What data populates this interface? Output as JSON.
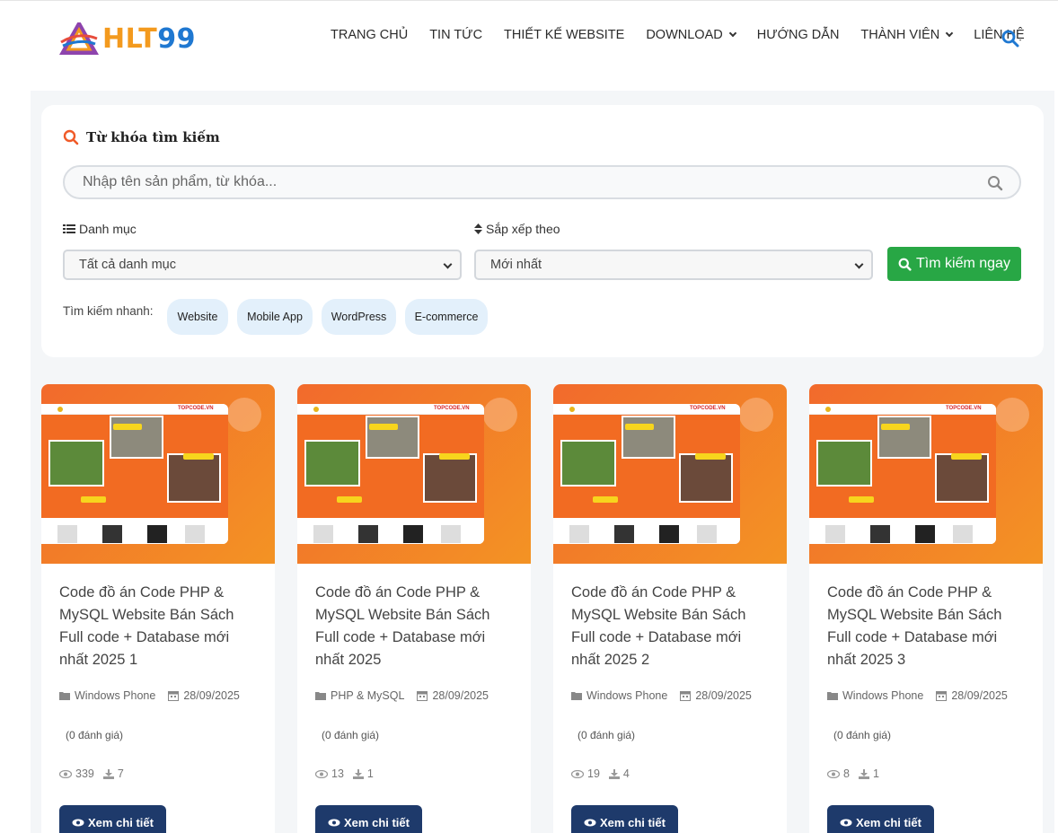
{
  "brand": {
    "logo_hlt": "HLT",
    "logo_num": "99"
  },
  "nav": {
    "items": [
      {
        "label": "TRANG CHỦ",
        "dropdown": false
      },
      {
        "label": "TIN TỨC",
        "dropdown": false
      },
      {
        "label": "THIẾT KẾ WEBSITE",
        "dropdown": false
      },
      {
        "label": "DOWNLOAD",
        "dropdown": true
      },
      {
        "label": "HƯỚNG DẪN",
        "dropdown": false
      },
      {
        "label": "THÀNH VIÊN",
        "dropdown": true
      },
      {
        "label": "LIÊN HỆ",
        "dropdown": false
      }
    ]
  },
  "search": {
    "title": "Từ khóa tìm kiếm",
    "placeholder": "Nhập tên sản phẩm, từ khóa...",
    "category_label": "Danh mục",
    "category_value": "Tất cả danh mục",
    "sort_label": "Sắp xếp theo",
    "sort_value": "Mới nhất",
    "button_label": "Tìm kiếm ngay",
    "quick_label": "Tìm kiếm nhanh:",
    "chips": [
      "Website",
      "Mobile App",
      "WordPress",
      "E-commerce"
    ]
  },
  "products": [
    {
      "title": "Code đồ án Code PHP & MySQL Website Bán Sách Full code + Database mới nhất 2025 1",
      "category": "Windows Phone",
      "date": "28/09/2025",
      "rating": "(0 đánh giá)",
      "views": "339",
      "downloads": "7",
      "button": "Xem chi tiết"
    },
    {
      "title": "Code đồ án Code PHP & MySQL Website Bán Sách Full code + Database mới nhất 2025",
      "category": "PHP & MySQL",
      "date": "28/09/2025",
      "rating": "(0 đánh giá)",
      "views": "13",
      "downloads": "1",
      "button": "Xem chi tiết"
    },
    {
      "title": "Code đồ án Code PHP & MySQL Website Bán Sách Full code + Database mới nhất 2025 2",
      "category": "Windows Phone",
      "date": "28/09/2025",
      "rating": "(0 đánh giá)",
      "views": "19",
      "downloads": "4",
      "button": "Xem chi tiết"
    },
    {
      "title": "Code đồ án Code PHP & MySQL Website Bán Sách Full code + Database mới nhất 2025 3",
      "category": "Windows Phone",
      "date": "28/09/2025",
      "rating": "(0 đánh giá)",
      "views": "8",
      "downloads": "1",
      "button": "Xem chi tiết"
    }
  ],
  "thumbnail": {
    "brand": "TOPCODE.VN"
  },
  "colors": {
    "accent_green": "#28a745",
    "accent_blue": "#1f78d1",
    "button_navy": "#1e3a6b",
    "thumb_orange": "#f26a2c",
    "search_orange": "#f05a28"
  }
}
